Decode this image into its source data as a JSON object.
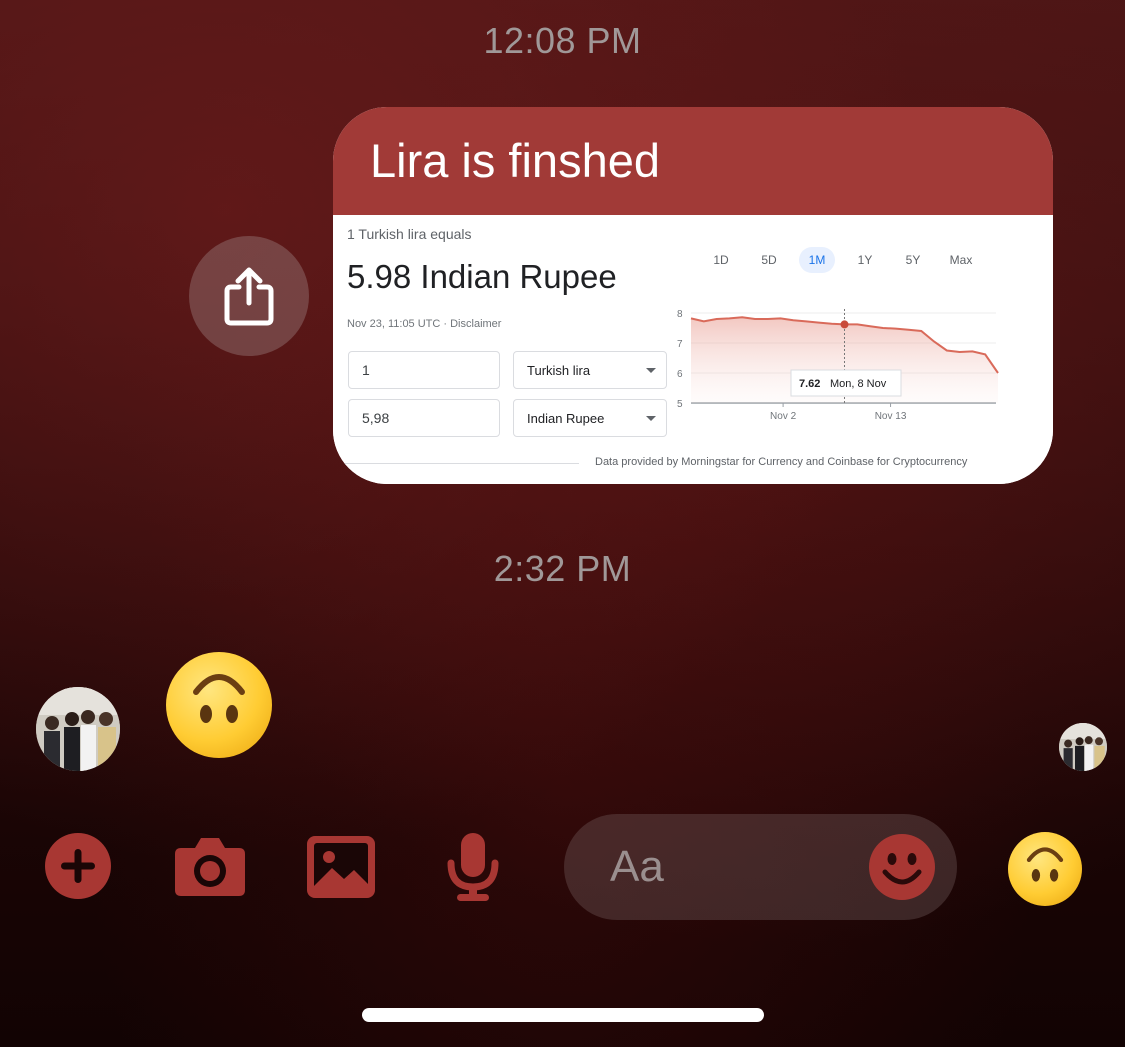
{
  "timestamps": [
    "12:08 PM",
    "2:32 PM"
  ],
  "colors": {
    "accent": "#a13a37",
    "icon": "#a83733"
  },
  "message": {
    "text": "Lira is finshed",
    "card": {
      "heading": "1 Turkish lira equals",
      "result": "5.98 Indian Rupee",
      "date": "Nov 23, 11:05 UTC · Disclaimer",
      "amount_from": "1",
      "amount_to": "5,98",
      "currency_from": "Turkish lira",
      "currency_to": "Indian Rupee",
      "ranges": [
        "1D",
        "5D",
        "1M",
        "1Y",
        "5Y",
        "Max"
      ],
      "active_range": "1M",
      "tooltip_value": "7.62",
      "tooltip_date": "Mon, 8 Nov",
      "footer": "Data provided by Morningstar for Currency and Coinbase for Cryptocurrency"
    }
  },
  "chart_data": {
    "type": "area",
    "ylim": [
      5,
      8
    ],
    "yticks": [
      "8",
      "7",
      "6",
      "5"
    ],
    "xtick_labels": [
      "Nov 2",
      "Nov 13"
    ],
    "values": [
      7.82,
      7.72,
      7.8,
      7.82,
      7.86,
      7.8,
      7.8,
      7.82,
      7.76,
      7.72,
      7.68,
      7.64,
      7.62,
      7.62,
      7.56,
      7.5,
      7.48,
      7.44,
      7.4,
      7.05,
      6.75,
      6.7,
      6.72,
      6.62,
      6.0
    ],
    "highlight": {
      "index": 12,
      "value": 7.62,
      "label": "Mon, 8 Nov"
    },
    "grid": true,
    "color": "#d96a5a"
  },
  "composer": {
    "placeholder": "Aa"
  },
  "icons": {
    "share": "share-icon",
    "plus": "plus-icon",
    "camera": "camera-icon",
    "photo": "photo-icon",
    "mic": "microphone-icon",
    "emoji": "smiley-icon",
    "like": "upside-down-face-emoji"
  }
}
